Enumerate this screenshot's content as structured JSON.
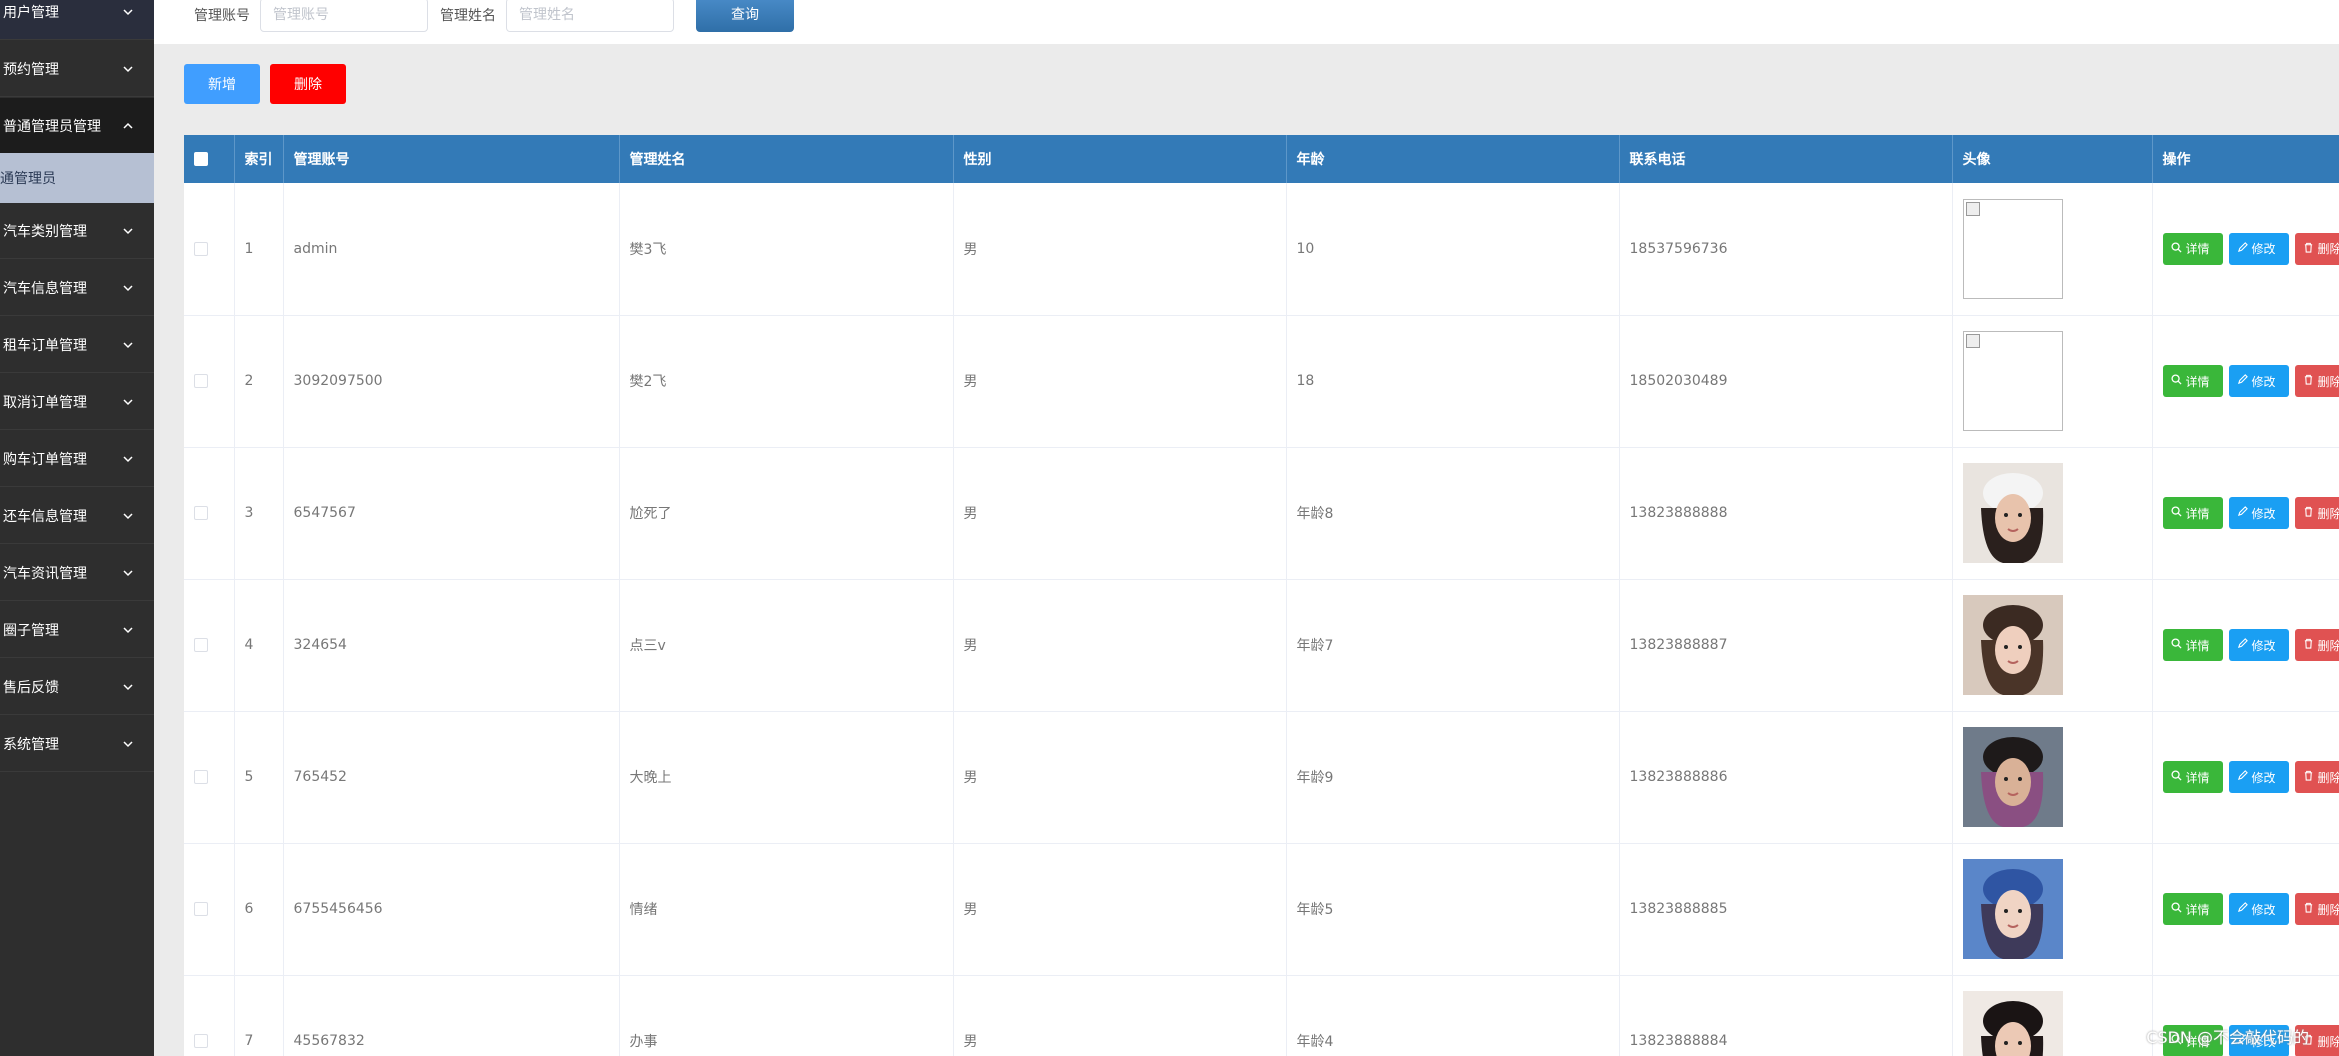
{
  "sidebar": {
    "items": [
      {
        "label": "用户管理"
      },
      {
        "label": "预约管理"
      },
      {
        "label": "普通管理员管理"
      },
      {
        "label": "汽车类别管理"
      },
      {
        "label": "汽车信息管理"
      },
      {
        "label": "租车订单管理"
      },
      {
        "label": "取消订单管理"
      },
      {
        "label": "购车订单管理"
      },
      {
        "label": "还车信息管理"
      },
      {
        "label": "汽车资讯管理"
      },
      {
        "label": "圈子管理"
      },
      {
        "label": "售后反馈"
      },
      {
        "label": "系统管理"
      }
    ],
    "sub_item": "通管理员"
  },
  "search": {
    "account_label": "管理账号",
    "account_placeholder": "管理账号",
    "name_label": "管理姓名",
    "name_placeholder": "管理姓名",
    "query_button": "查询"
  },
  "actions": {
    "add": "新增",
    "delete": "删除"
  },
  "table": {
    "headers": [
      "索引",
      "管理账号",
      "管理姓名",
      "性别",
      "年龄",
      "联系电话",
      "头像",
      "操作"
    ],
    "op_labels": {
      "detail": "详情",
      "edit": "修改",
      "delete": "删除"
    },
    "rows": [
      {
        "index": "1",
        "account": "admin",
        "name": "樊3飞",
        "gender": "男",
        "age": "10",
        "phone": "18537596736",
        "avatar": "broken"
      },
      {
        "index": "2",
        "account": "3092097500",
        "name": "樊2飞",
        "gender": "男",
        "age": "18",
        "phone": "18502030489",
        "avatar": "broken"
      },
      {
        "index": "3",
        "account": "6547567",
        "name": "尬死了",
        "gender": "男",
        "age": "年龄8",
        "phone": "13823888888",
        "avatar": "photo-girl-white-cap"
      },
      {
        "index": "4",
        "account": "324654",
        "name": "点三v",
        "gender": "男",
        "age": "年龄7",
        "phone": "13823888887",
        "avatar": "photo-girl-long-hair"
      },
      {
        "index": "5",
        "account": "765452",
        "name": "大晚上",
        "gender": "男",
        "age": "年龄9",
        "phone": "13823888886",
        "avatar": "photo-boy-backpack"
      },
      {
        "index": "6",
        "account": "6755456456",
        "name": "情绪",
        "gender": "男",
        "age": "年龄5",
        "phone": "13823888885",
        "avatar": "photo-girl-blue-cap"
      },
      {
        "index": "7",
        "account": "45567832",
        "name": "办事",
        "gender": "男",
        "age": "年龄4",
        "phone": "13823888884",
        "avatar": "photo-girl-dark-hair"
      }
    ]
  },
  "watermark": "CSDN @不会敲代码的",
  "colors": {
    "header": "#337ab7",
    "sidebar": "#2e2e2e",
    "detail": "#3ab73a",
    "edit": "#1a9ff3",
    "delete": "#e05252",
    "add": "#409eff",
    "danger": "#ff0000"
  }
}
